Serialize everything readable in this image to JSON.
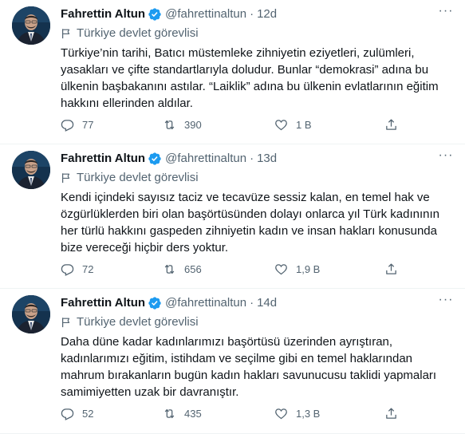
{
  "tweets": [
    {
      "name": "Fahrettin Altun",
      "handle": "@fahrettinaltun",
      "dot": "·",
      "time": "12d",
      "label": "Türkiye devlet görevlisi",
      "text": "Türkiye’nin tarihi, Batıcı müstemleke zihniyetin eziyetleri, zulümleri, yasakları ve çifte standartlarıyla doludur. Bunlar “demokrasi” adına bu ülkenin başbakanını astılar. “Laiklik” adına bu ülkenin evlatlarının eğitim hakkını ellerinden aldılar.",
      "replies": "77",
      "retweets": "390",
      "likes": "1 B"
    },
    {
      "name": "Fahrettin Altun",
      "handle": "@fahrettinaltun",
      "dot": "·",
      "time": "13d",
      "label": "Türkiye devlet görevlisi",
      "text": "Kendi içindeki sayısız taciz ve tecavüze sessiz kalan, en temel hak ve özgürlüklerden biri olan başörtüsünden dolayı onlarca yıl Türk kadınının her türlü hakkını gaspeden zihniyetin kadın ve insan hakları konusunda bize vereceği hiçbir ders yoktur.",
      "replies": "72",
      "retweets": "656",
      "likes": "1,9 B"
    },
    {
      "name": "Fahrettin Altun",
      "handle": "@fahrettinaltun",
      "dot": "·",
      "time": "14d",
      "label": "Türkiye devlet görevlisi",
      "text": "Daha düne kadar kadınlarımızı başörtüsü üzerinden ayrıştıran, kadınlarımızı eğitim, istihdam ve seçilme gibi en temel haklarından mahrum bırakanların bugün kadın hakları savunucusu taklidi yapmaları samimiyetten uzak bir davranıştır.",
      "replies": "52",
      "retweets": "435",
      "likes": "1,3 B"
    }
  ],
  "colors": {
    "text": "#0f1419",
    "muted": "#536471",
    "verified": "#1d9bf0",
    "divider": "#eff3f4"
  },
  "icons": [
    "avatar",
    "verified-badge-icon",
    "flag-icon",
    "more-icon",
    "reply-icon",
    "retweet-icon",
    "like-icon",
    "share-icon"
  ]
}
